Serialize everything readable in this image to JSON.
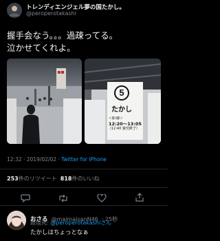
{
  "tweet": {
    "author_name": "トレンディエンジェル夢の国たかし。",
    "author_handle": "@peroperotakashi",
    "text": "握手会なう。。。過疎ってる。\n泣かせてくれよ。",
    "photo_sign": {
      "number": "5",
      "name": "たかし",
      "label_part": "＜第3部＞",
      "time": "12:20～13:05",
      "closing": "（12:40 受付終了）"
    },
    "timestamp": "12:32 · 2019/02/02 · ",
    "via": "Twitter for iPhone",
    "retweet_count": "253",
    "retweet_label": "件のリツイート",
    "like_count": "818",
    "like_label": "件のいいね"
  },
  "reply": {
    "author_name": "おさる",
    "author_handle": "@maimaisanN46",
    "time_ago": "· 25秒",
    "replying_to_prefix": "返信先: ",
    "replying_to_handle": "@peroperotakashiさん",
    "text": "たかしはちょっとなぁ"
  },
  "colors": {
    "background": "#000000",
    "link": "#1d9bf0",
    "secondary_text": "#7d8790",
    "divider": "#22272c"
  }
}
